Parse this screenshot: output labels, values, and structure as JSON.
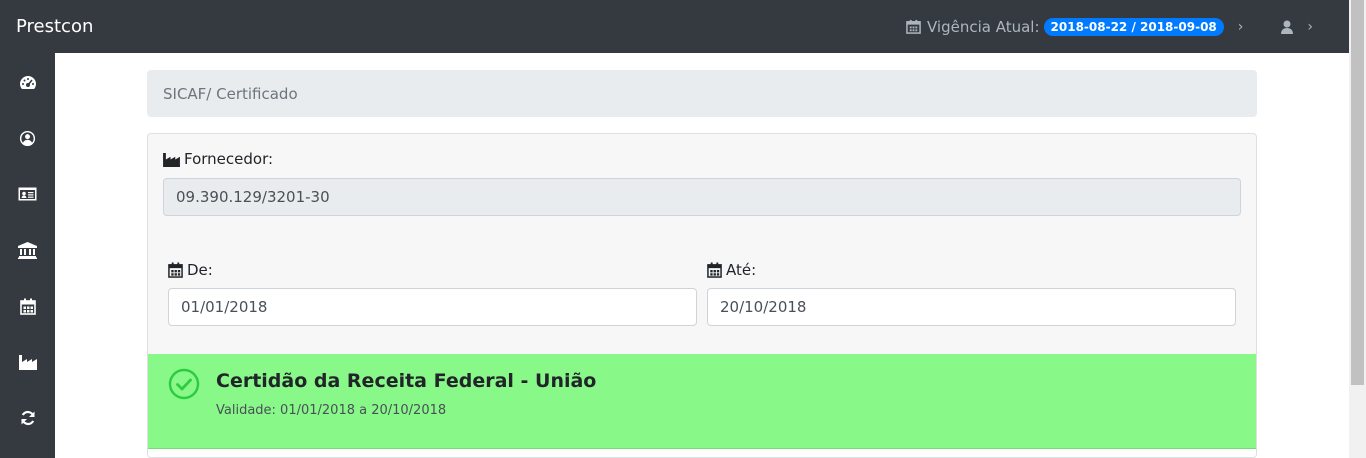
{
  "app": {
    "brand": "Prestcon"
  },
  "header": {
    "vigencia_label": "Vigência Atual:",
    "vigencia_badge": "2018-08-22 / 2018-09-08",
    "calendar_icon": "calendar-icon",
    "user_icon": "user-icon"
  },
  "sidebar": {
    "items": [
      {
        "icon": "dashboard-icon"
      },
      {
        "icon": "user-circle-icon"
      },
      {
        "icon": "id-card-icon"
      },
      {
        "icon": "bank-icon"
      },
      {
        "icon": "calendar-icon"
      },
      {
        "icon": "factory-icon"
      },
      {
        "icon": "refresh-icon"
      }
    ]
  },
  "breadcrumb": {
    "text": "SICAF/ Certificado"
  },
  "form": {
    "fornecedor_label": "Fornecedor:",
    "fornecedor_value": "09.390.129/3201-30",
    "de_label": "De:",
    "de_value": "01/01/2018",
    "ate_label": "Até:",
    "ate_value": "20/10/2018"
  },
  "certidao": {
    "title": "Certidão da Receita Federal - União",
    "validity": "Validade: 01/01/2018 a 20/10/2018",
    "status_icon": "check-circle-icon",
    "color": "#88f888"
  },
  "colors": {
    "navbar": "#343a40",
    "badge": "#007bff",
    "success": "#88f888"
  }
}
